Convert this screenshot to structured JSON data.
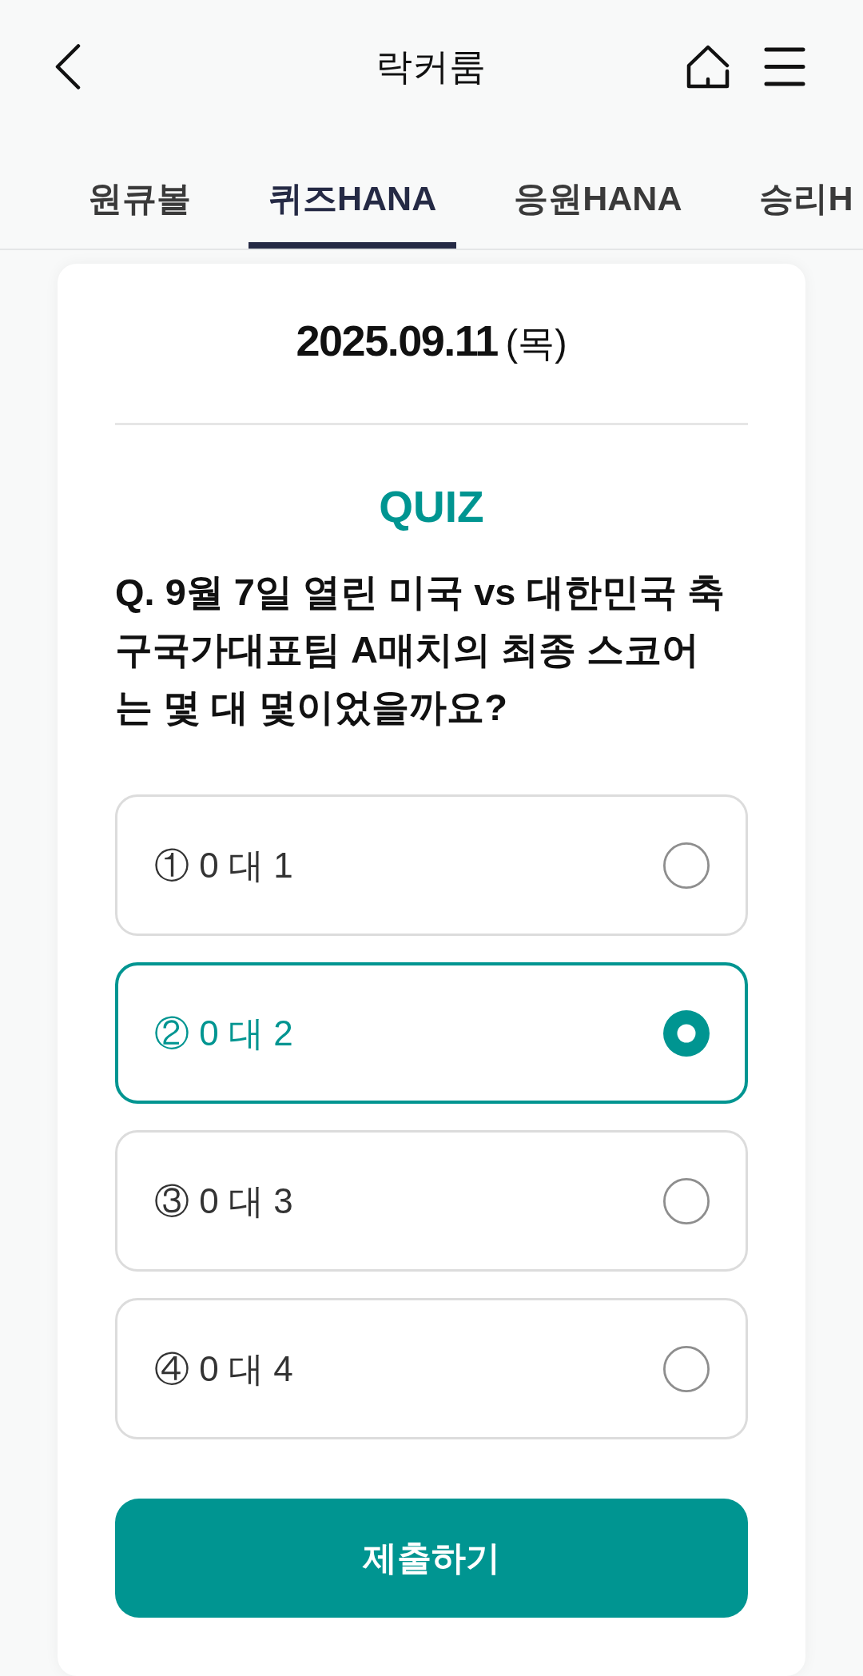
{
  "header": {
    "title": "락커룸"
  },
  "tabs": [
    {
      "label": "원큐볼",
      "selected": false
    },
    {
      "label": "퀴즈HANA",
      "selected": true
    },
    {
      "label": "응원HANA",
      "selected": false
    },
    {
      "label": "승리H",
      "selected": false
    }
  ],
  "quiz_card": {
    "date": "2025.09.11",
    "weekday": "(목)",
    "heading": "QUIZ",
    "question": "Q. 9월 7일 열린 미국 vs 대한민국 축구국가대표팀 A매치의 최종 스코어는 몇 대 몇이었을까요?",
    "options": [
      {
        "label": "① 0 대 1",
        "selected": false
      },
      {
        "label": "② 0 대 2",
        "selected": true
      },
      {
        "label": "③ 0 대 3",
        "selected": false
      },
      {
        "label": "④ 0 대 4",
        "selected": false
      }
    ],
    "submit_button": {
      "label": "제출하기"
    }
  }
}
